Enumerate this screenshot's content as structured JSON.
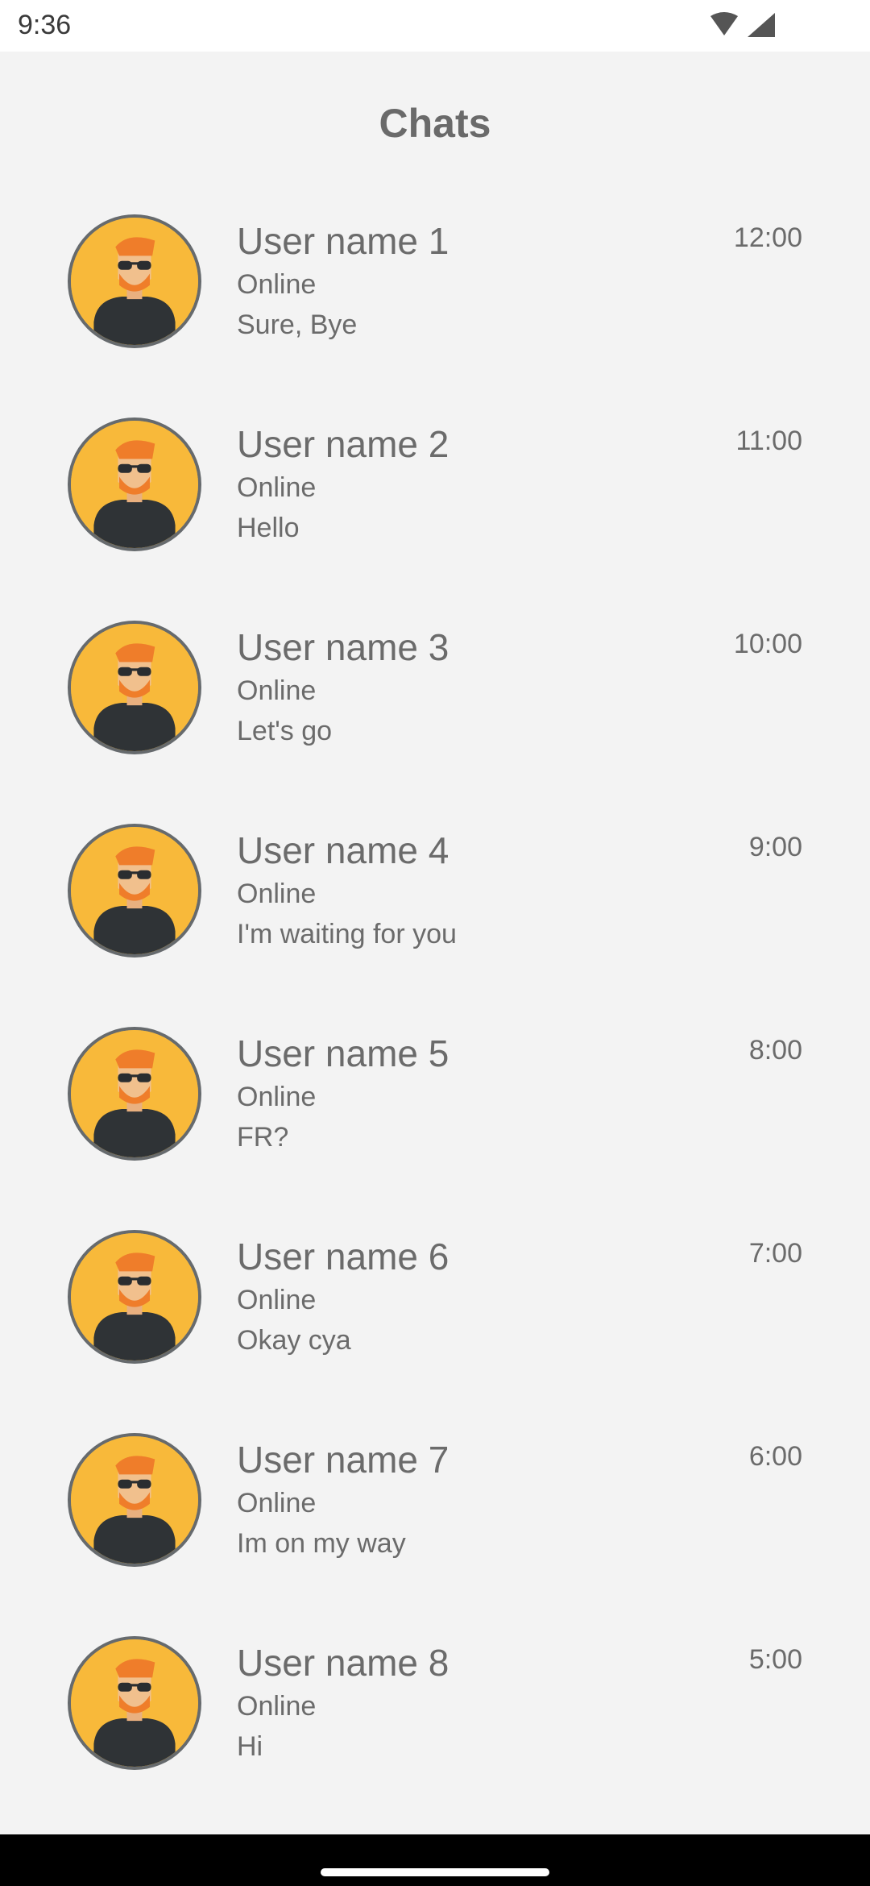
{
  "status_bar": {
    "time": "9:36",
    "icons": [
      "wifi-icon",
      "signal-icon"
    ]
  },
  "header": {
    "title": "Chats"
  },
  "colors": {
    "background": "#f3f3f3",
    "avatar_bg": "#f8b93a",
    "avatar_border": "#666a6d",
    "text": "#6b6b6b"
  },
  "chats": [
    {
      "name": "User name 1",
      "status": "Online",
      "last_message": "Sure, Bye",
      "time": "12:00"
    },
    {
      "name": "User name 2",
      "status": "Online",
      "last_message": "Hello",
      "time": "11:00"
    },
    {
      "name": "User name 3",
      "status": "Online",
      "last_message": "Let's go",
      "time": "10:00"
    },
    {
      "name": "User name 4",
      "status": "Online",
      "last_message": "I'm waiting for you",
      "time": "9:00"
    },
    {
      "name": "User name 5",
      "status": "Online",
      "last_message": "FR?",
      "time": "8:00"
    },
    {
      "name": "User name 6",
      "status": "Online",
      "last_message": "Okay cya",
      "time": "7:00"
    },
    {
      "name": "User name 7",
      "status": "Online",
      "last_message": "Im on my way",
      "time": "6:00"
    },
    {
      "name": "User name 8",
      "status": "Online",
      "last_message": "Hi",
      "time": "5:00"
    }
  ]
}
